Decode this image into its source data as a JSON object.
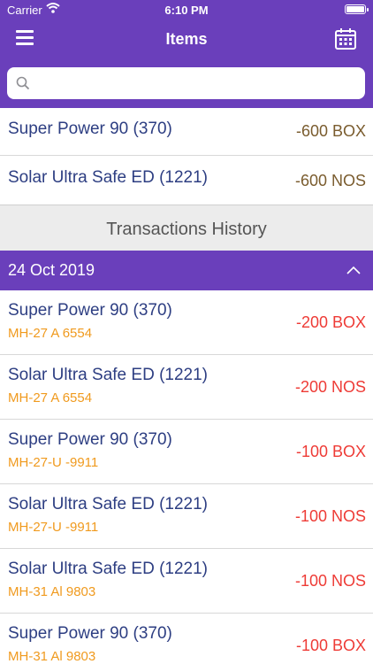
{
  "status_bar": {
    "carrier": "Carrier",
    "time": "6:10 PM"
  },
  "nav": {
    "title": "Items"
  },
  "search": {
    "placeholder": ""
  },
  "items": [
    {
      "name": "Super Power 90 (370)",
      "qty": "-600 BOX"
    },
    {
      "name": "Solar Ultra Safe ED (1221)",
      "qty": "-600 NOS"
    }
  ],
  "history": {
    "title": "Transactions History",
    "date": "24 Oct 2019",
    "transactions": [
      {
        "name": "Super Power 90 (370)",
        "vehicle": "MH-27 A 6554",
        "qty": "-200 BOX"
      },
      {
        "name": "Solar Ultra Safe ED (1221)",
        "vehicle": "MH-27 A 6554",
        "qty": "-200 NOS"
      },
      {
        "name": "Super Power 90 (370)",
        "vehicle": "MH-27-U -9911",
        "qty": "-100 BOX"
      },
      {
        "name": "Solar Ultra Safe ED (1221)",
        "vehicle": "MH-27-U -9911",
        "qty": "-100 NOS"
      },
      {
        "name": "Solar Ultra Safe ED (1221)",
        "vehicle": "MH-31 Al 9803",
        "qty": "-100 NOS"
      },
      {
        "name": "Super Power 90 (370)",
        "vehicle": "MH-31 Al 9803",
        "qty": "-100 BOX"
      }
    ]
  },
  "colors": {
    "brand": "#6a3fbb",
    "item_name": "#2d3e82",
    "vehicle": "#f09a1e",
    "tx_qty": "#ee3b36",
    "item_qty": "#7a5c2e"
  },
  "icons": [
    "wifi-icon",
    "battery-icon",
    "menu-icon",
    "calendar-icon",
    "search-icon",
    "chevron-up-icon"
  ]
}
